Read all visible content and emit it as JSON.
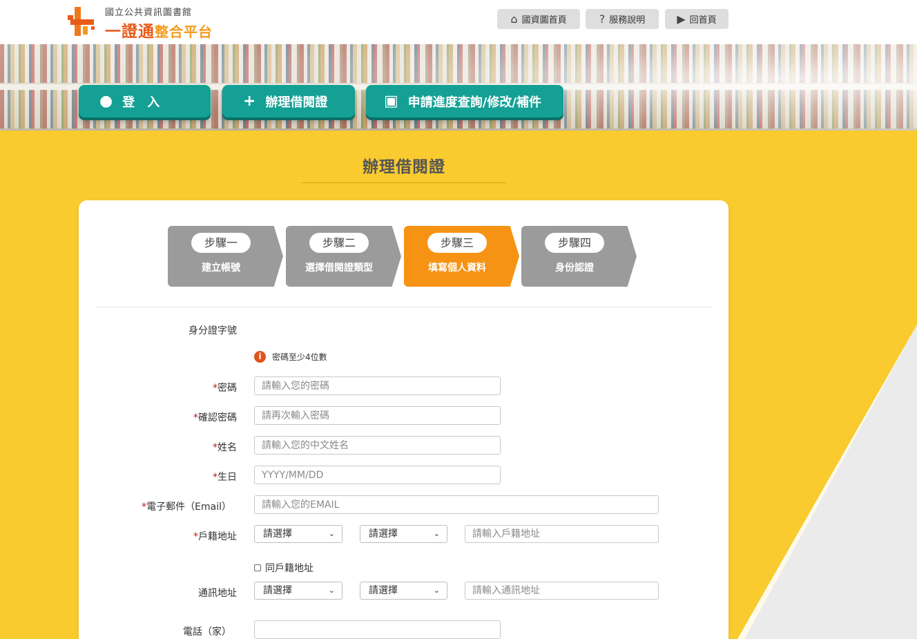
{
  "header": {
    "logo": {
      "subtitle": "國立公共資訊圖書館",
      "title_part1": "一證通",
      "title_part2": "整合平台",
      "accent": "#e85b1a"
    },
    "nav": [
      {
        "label": "國資圖首頁",
        "icon": "home-icon"
      },
      {
        "label": "服務說明",
        "icon": "question-icon"
      },
      {
        "label": "回首頁",
        "icon": "play-icon"
      }
    ]
  },
  "banner": {
    "buttons": [
      {
        "label": "登　入",
        "icon": "user-icon"
      },
      {
        "label": "辦理借閱證",
        "icon": "plus-icon"
      },
      {
        "label": "申請進度查詢/修改/補件",
        "icon": "monitor-icon"
      }
    ],
    "button_color": "#14a094"
  },
  "page": {
    "title": "辦理借閱證",
    "background": "#f9cb2e"
  },
  "steps": [
    {
      "step": "步驟一",
      "label": "建立帳號",
      "active": false
    },
    {
      "step": "步驟二",
      "label": "選擇借閱證類型",
      "active": false
    },
    {
      "step": "步驟三",
      "label": "填寫個人資料",
      "active": true
    },
    {
      "step": "步驟四",
      "label": "身份認證",
      "active": false
    }
  ],
  "form": {
    "id_label": "身分證字號",
    "hint": "密碼至少4位數",
    "required_mark": "*",
    "password": {
      "label": "密碼",
      "placeholder": "請輸入您的密碼"
    },
    "confirm_password": {
      "label": "確認密碼",
      "placeholder": "請再次輸入密碼"
    },
    "name": {
      "label": "姓名",
      "placeholder": "請輸入您的中文姓名"
    },
    "birthday": {
      "label": "生日",
      "placeholder": "YYYY/MM/DD"
    },
    "email": {
      "label": "電子郵件（Email）",
      "placeholder": "請輸入您的EMAIL"
    },
    "household_address": {
      "label": "戶籍地址",
      "city": "請選擇",
      "district": "請選擇",
      "placeholder": "請輸入戶籍地址"
    },
    "same_as_household": {
      "label": "同戶籍地址",
      "checked": false
    },
    "mailing_address": {
      "label": "通訊地址",
      "city": "請選擇",
      "district": "請選擇",
      "placeholder": "請輸入通訊地址"
    },
    "phone_home": {
      "label": "電話（家）",
      "value": ""
    }
  }
}
